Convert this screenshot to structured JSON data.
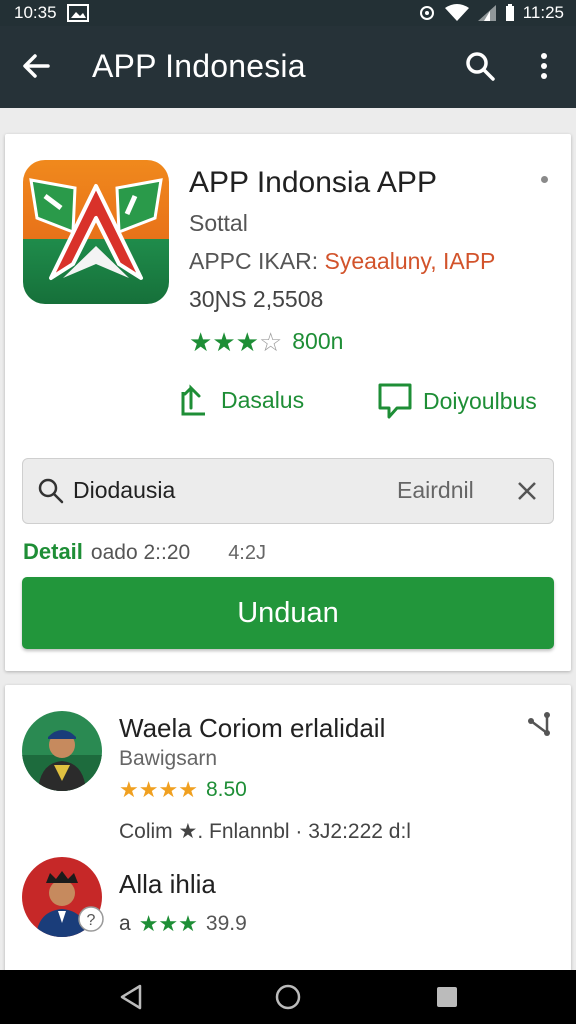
{
  "status_bar": {
    "time_left": "10:35",
    "time_right": "11:25"
  },
  "toolbar": {
    "title": "APP Indonesia",
    "back_icon": "arrow-back-icon",
    "search_icon": "search-icon",
    "more_icon": "more-vert-icon"
  },
  "app": {
    "title": "APP Indonsia APP",
    "subtitle": "Sottal",
    "developer_prefix": "APPC IKAR:",
    "developer_accent": "Syeaaluny, IAPP",
    "meta": "30ƝS 2,5508",
    "rating_stars": 3,
    "rating_count": "800n",
    "actions": [
      {
        "label": "Dasalus",
        "icon": "share-icon"
      },
      {
        "label": "Doiyoulbus",
        "icon": "comment-icon"
      }
    ],
    "search": {
      "query": "Diodausia",
      "extra": "Eairdnil"
    },
    "detail": {
      "label": "Detail",
      "time": "oado 2::20",
      "number": "4:2J"
    },
    "install_label": "Unduan",
    "colors": {
      "accent": "#1e8e36",
      "toolbar": "#263238",
      "button": "#22963b",
      "developer_accent": "#d2532b"
    }
  },
  "related": [
    {
      "title": "Waela Coriom erlalidail",
      "subtitle": "Bawigsarn",
      "rating": "8.50",
      "meta": "Colim ★. Fnlannbl · 3J2:222 d:l"
    },
    {
      "title": "Alla ihlia",
      "prefix": "a",
      "rating": "39.9"
    }
  ]
}
